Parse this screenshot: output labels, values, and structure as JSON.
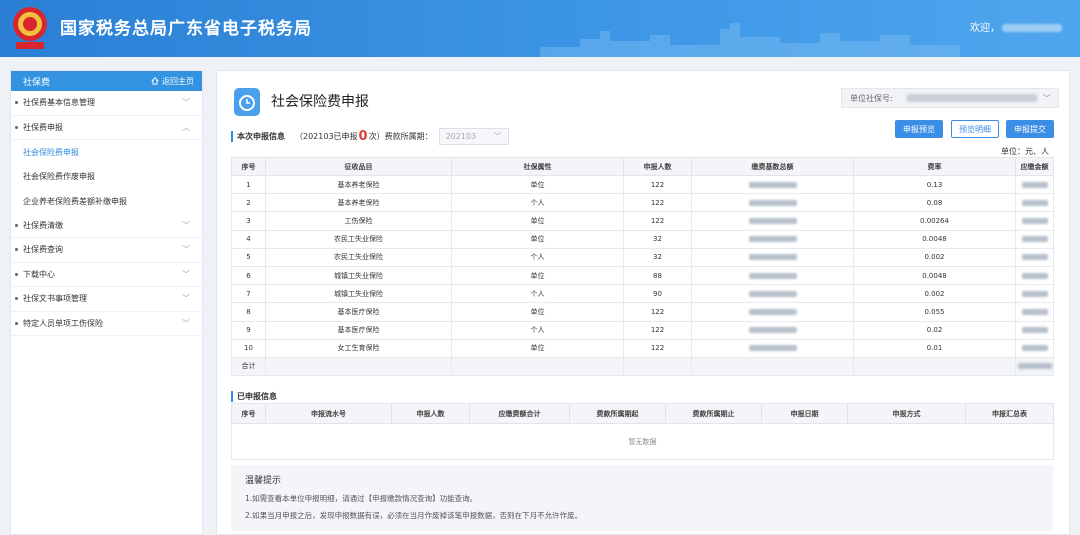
{
  "header": {
    "title": "国家税务总局广东省电子税务局",
    "welcome": "欢迎，"
  },
  "sidebar": {
    "title": "社保费",
    "home_link": "返回主页",
    "items": [
      {
        "label": "社保费基本信息管理",
        "chevron": "﹀"
      },
      {
        "label": "社保费申报",
        "chevron": "︿"
      },
      {
        "label": "社保费清缴",
        "chevron": "﹀"
      },
      {
        "label": "社保费查询",
        "chevron": "﹀"
      },
      {
        "label": "下载中心",
        "chevron": "﹀"
      },
      {
        "label": "社保文书事项管理",
        "chevron": "﹀"
      },
      {
        "label": "特定人员单项工伤保险",
        "chevron": "﹀"
      }
    ],
    "sub_items": [
      "社会保险费申报",
      "社会保险费作废申报",
      "企业养老保险费差额补缴申报"
    ]
  },
  "main": {
    "title": "社会保险费申报",
    "unit_no_label": "单位社保号:",
    "info_label": "本次申报信息",
    "info_prefix": "（202103已申报",
    "info_count": "0",
    "info_suffix": "次）费款所属期：",
    "period_value": "202103",
    "btn_preview": "申报预览",
    "btn_detail": "预览明细",
    "btn_submit": "申报提交",
    "unit_label": "单位：元、人",
    "colors": {
      "accent": "#3a8ee6",
      "count": "#e13c3c"
    }
  },
  "table1": {
    "headers": [
      "序号",
      "征收品目",
      "社保属性",
      "申报人数",
      "缴费基数总额",
      "费率",
      "应缴金额"
    ],
    "rows": [
      {
        "no": "1",
        "item": "基本养老保险",
        "attr": "单位",
        "count": "122",
        "rate": "0.13"
      },
      {
        "no": "2",
        "item": "基本养老保险",
        "attr": "个人",
        "count": "122",
        "rate": "0.08"
      },
      {
        "no": "3",
        "item": "工伤保险",
        "attr": "单位",
        "count": "122",
        "rate": "0.00264"
      },
      {
        "no": "4",
        "item": "农民工失业保险",
        "attr": "单位",
        "count": "32",
        "rate": "0.0048"
      },
      {
        "no": "5",
        "item": "农民工失业保险",
        "attr": "个人",
        "count": "32",
        "rate": "0.002"
      },
      {
        "no": "6",
        "item": "城镇工失业保险",
        "attr": "单位",
        "count": "88",
        "rate": "0.0048"
      },
      {
        "no": "7",
        "item": "城镇工失业保险",
        "attr": "个人",
        "count": "90",
        "rate": "0.002"
      },
      {
        "no": "8",
        "item": "基本医疗保险",
        "attr": "单位",
        "count": "122",
        "rate": "0.055"
      },
      {
        "no": "9",
        "item": "基本医疗保险",
        "attr": "个人",
        "count": "122",
        "rate": "0.02"
      },
      {
        "no": "10",
        "item": "女工生育保险",
        "attr": "单位",
        "count": "122",
        "rate": "0.01"
      }
    ],
    "total_label": "合计"
  },
  "section2": {
    "title": "已申报信息",
    "headers": [
      "序号",
      "申报流水号",
      "申报人数",
      "应缴费额合计",
      "费款所属期起",
      "费款所属期止",
      "申报日期",
      "申报方式",
      "申报汇总表"
    ],
    "empty_text": "暂无数据"
  },
  "tips": {
    "title": "温馨提示",
    "lines": [
      "1.如需查看本单位申报明细，请通过【申报缴款情况查询】功能查询。",
      "2.如果当月申报之后，发现申报数据有误，必须在当月作废掉该笔申报数据，否则在下月不允许作废。"
    ]
  }
}
